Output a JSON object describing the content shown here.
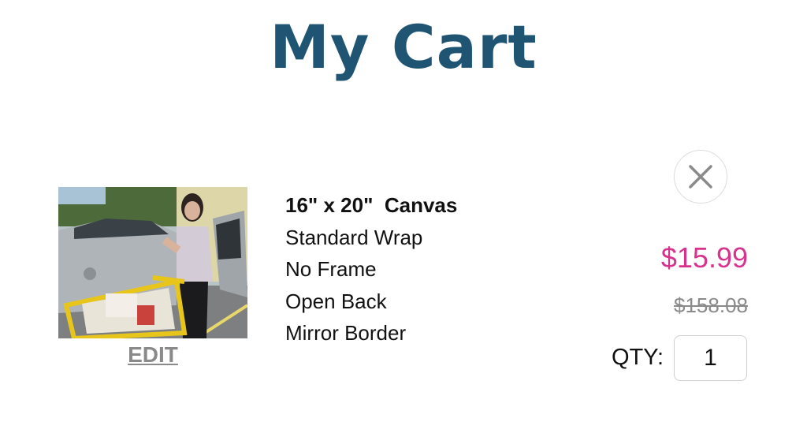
{
  "header": {
    "title": "My Cart"
  },
  "cart_item": {
    "thumbnail": "photo-of-woman-with-shopping-cart",
    "edit_label": "EDIT",
    "size": "16\" x 20\"  Canvas",
    "options": [
      "Standard Wrap",
      "No Frame",
      "Open Back",
      "Mirror Border"
    ],
    "price": "$15.99",
    "original_price": "$158.08",
    "qty_label": "QTY:",
    "qty_value": "1",
    "remove_icon": "close-icon"
  },
  "colors": {
    "title": "#1f5473",
    "price": "#d8328f",
    "muted": "#8a8a8a"
  }
}
